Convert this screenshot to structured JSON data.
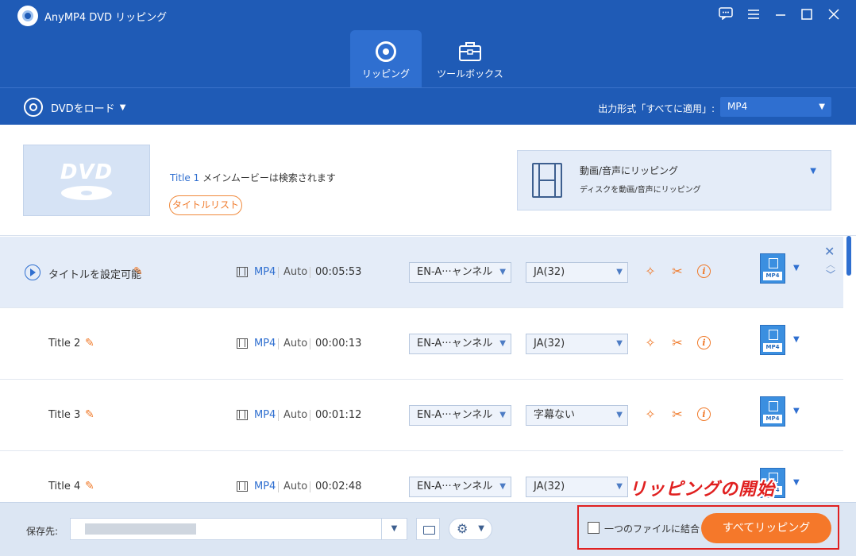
{
  "app": {
    "title": "AnyMP4 DVD リッピング"
  },
  "window_controls": [
    {
      "name": "feedback-icon",
      "glyph": "☐"
    },
    {
      "name": "menu-icon",
      "glyph": "☰"
    },
    {
      "name": "minimize-icon",
      "glyph": "—"
    },
    {
      "name": "maximize-icon",
      "glyph": "☐"
    },
    {
      "name": "close-icon",
      "glyph": "✕"
    }
  ],
  "nav": {
    "tabs": [
      {
        "label": "リッピング",
        "icon": "ripper-icon",
        "active": true
      },
      {
        "label": "ツールボックス",
        "icon": "toolbox-icon",
        "active": false
      }
    ]
  },
  "toolbar": {
    "load_dvd": "DVDをロード",
    "output_label": "出力形式「すべてに適用」:",
    "output_value": "MP4"
  },
  "disc": {
    "thumb_text": "DVD",
    "title_name": "Title 1",
    "title_desc": "メインムービーは検索されます",
    "title_list_button": "タイトルリスト"
  },
  "rip_mode": {
    "title": "動画/音声にリッピング",
    "subtitle": "ディスクを動画/音声にリッピング"
  },
  "titles": [
    {
      "name": "タイトルを設定可能",
      "format": "MP4",
      "quality": "Auto",
      "duration": "00:05:53",
      "audio": "EN-A···ャンネル",
      "subtitle": "JA(32)",
      "output": "MP4",
      "selected": true
    },
    {
      "name": "Title 2",
      "format": "MP4",
      "quality": "Auto",
      "duration": "00:00:13",
      "audio": "EN-A···ャンネル",
      "subtitle": "JA(32)",
      "output": "MP4",
      "selected": false
    },
    {
      "name": "Title 3",
      "format": "MP4",
      "quality": "Auto",
      "duration": "00:01:12",
      "audio": "EN-A···ャンネル",
      "subtitle": "字幕ない",
      "output": "MP4",
      "selected": false
    },
    {
      "name": "Title 4",
      "format": "MP4",
      "quality": "Auto",
      "duration": "00:02:48",
      "audio": "EN-A···ャンネル",
      "subtitle": "JA(32)",
      "output": "MP4",
      "selected": false
    }
  ],
  "bottom": {
    "save_label": "保存先:",
    "merge_label": "一つのファイルに結合",
    "rip_all_button": "すべてリッピング"
  },
  "annotation": {
    "text": "リッピングの開始",
    "color": "#e02020"
  },
  "colors": {
    "brand": "#1f5bb6",
    "accent": "#f5782a"
  }
}
